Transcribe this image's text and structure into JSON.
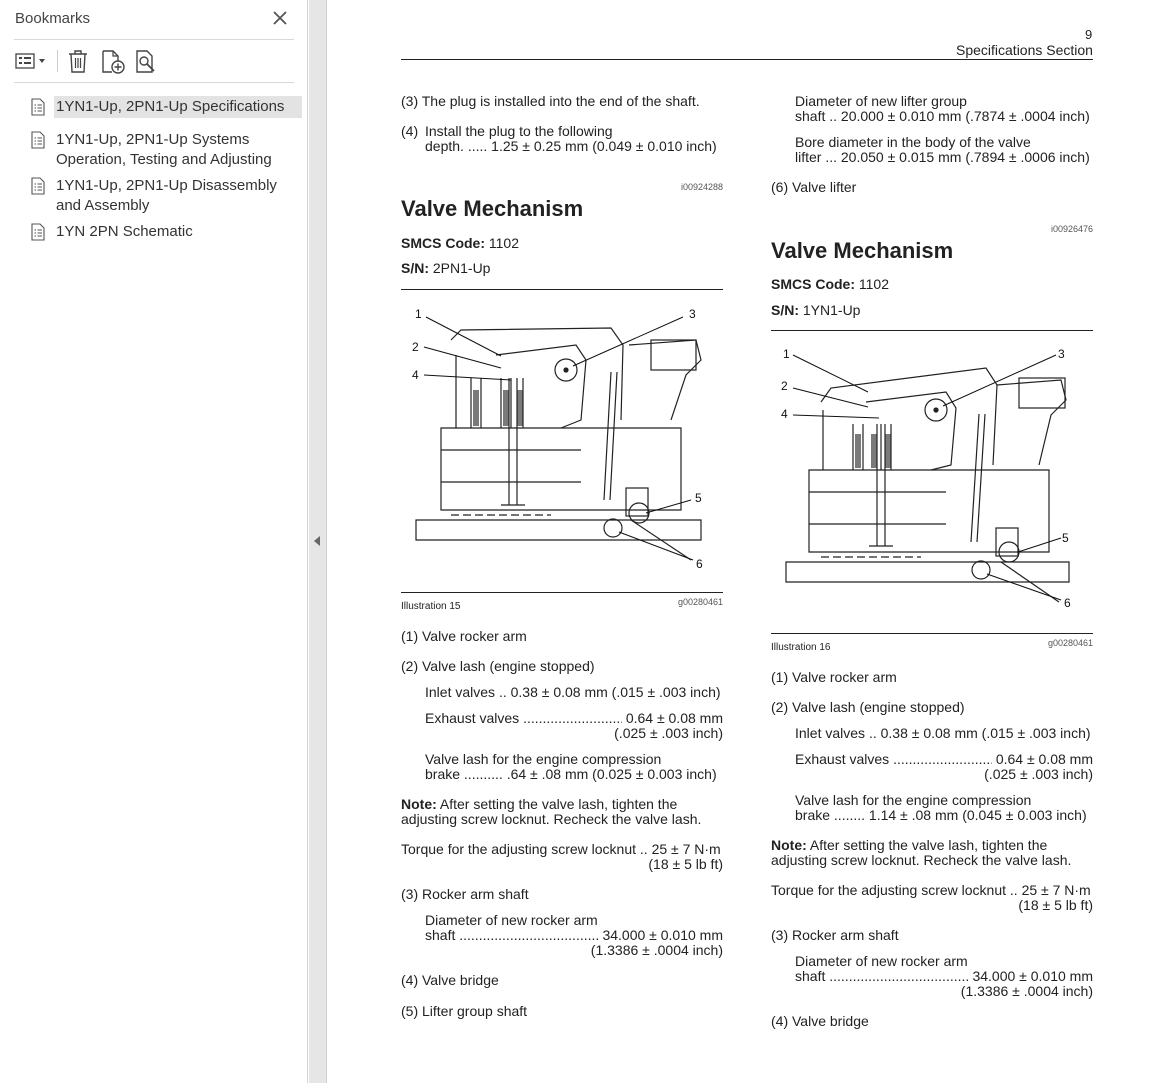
{
  "sidebar": {
    "title": "Bookmarks",
    "items": [
      {
        "label": "1YN1-Up, 2PN1-Up Specifications"
      },
      {
        "label": "1YN1-Up, 2PN1-Up Systems Operation, Testing and Adjusting"
      },
      {
        "label": "1YN1-Up, 2PN1-Up Disassembly and Assembly"
      },
      {
        "label": "1YN 2PN Schematic"
      }
    ]
  },
  "page": {
    "number": "9",
    "section": "Specifications Section",
    "left": {
      "p3": "(3) The plug is installed into the end of the shaft.",
      "p4_num": "(4)",
      "p4_line1": "Install the plug to the following",
      "p4_line2": "depth. ..... 1.25 ± 0.25 mm (0.049 ± 0.010 inch)",
      "code": "i00924288",
      "heading": "Valve Mechanism",
      "smcs_label": "SMCS Code:",
      "smcs_value": "1102",
      "sn_label": "S/N:",
      "sn_value": "2PN1-Up",
      "caption": "Illustration 15",
      "fig_code": "g00280461",
      "items": {
        "i1": "(1) Valve rocker arm",
        "i2": "(2) Valve lash (engine stopped)",
        "inlet_a": "Inlet valves",
        "inlet_b": ".. 0.38 ± 0.08 mm (.015 ± .003 inch)",
        "exhaust_a": "Exhaust valves",
        "exhaust_dots": "..........................................",
        "exhaust_b": "0.64 ± 0.08 mm",
        "exhaust_c": "(.025 ± .003 inch)",
        "brake_1": "Valve lash for the engine compression",
        "brake_2": "brake .......... .64 ± .08 mm (0.025 ± 0.003 inch)",
        "note_label": "Note:",
        "note_1": "After setting the valve lash, tighten the",
        "note_2": "adjusting screw locknut. Recheck the valve lash.",
        "torque_1": "Torque for the adjusting screw locknut .. 25 ± 7 N·m",
        "torque_2": "(18 ± 5 lb ft)",
        "i3": "(3) Rocker arm shaft",
        "dia_1": "Diameter of new rocker arm",
        "dia_2a": "shaft",
        "dia_dots": "..............................................................",
        "dia_2b": "34.000 ± 0.010 mm",
        "dia_3": "(1.3386 ± .0004 inch)",
        "i4": "(4) Valve bridge",
        "i5": "(5) Lifter group shaft"
      }
    },
    "right": {
      "lift_1": "Diameter of new lifter group",
      "lift_2": "shaft .. 20.000 ± 0.010 mm (.7874 ± .0004 inch)",
      "bore_1": "Bore diameter in the body of the valve",
      "bore_2": "lifter ... 20.050 ± 0.015 mm (.7894 ± .0006 inch)",
      "i6": "(6) Valve lifter",
      "code": "i00926476",
      "heading": "Valve Mechanism",
      "smcs_label": "SMCS Code:",
      "smcs_value": "1102",
      "sn_label": "S/N:",
      "sn_value": "1YN1-Up",
      "caption": "Illustration 16",
      "fig_code": "g00280461",
      "items": {
        "i1": "(1) Valve rocker arm",
        "i2": "(2) Valve lash (engine stopped)",
        "inlet_a": "Inlet valves",
        "inlet_b": ".. 0.38 ± 0.08 mm (.015 ± .003 inch)",
        "exhaust_a": "Exhaust valves",
        "exhaust_dots": "..........................................",
        "exhaust_b": "0.64 ± 0.08 mm",
        "exhaust_c": "(.025 ± .003 inch)",
        "brake_1": "Valve lash for the engine compression",
        "brake_2": "brake ........ 1.14 ± .08 mm (0.045 ± 0.003 inch)",
        "note_label": "Note:",
        "note_1": "After setting the valve lash, tighten the",
        "note_2": "adjusting screw locknut. Recheck the valve lash.",
        "torque_1": "Torque for the adjusting screw locknut .. 25 ± 7 N·m",
        "torque_2": "(18 ± 5 lb ft)",
        "i3": "(3) Rocker arm shaft",
        "dia_1": "Diameter of new rocker arm",
        "dia_2a": "shaft",
        "dia_dots": "..............................................................",
        "dia_2b": "34.000 ± 0.010 mm",
        "dia_3": "(1.3386 ± .0004 inch)",
        "i4": "(4) Valve bridge"
      }
    },
    "callouts": [
      "1",
      "2",
      "3",
      "4",
      "5",
      "6"
    ]
  }
}
